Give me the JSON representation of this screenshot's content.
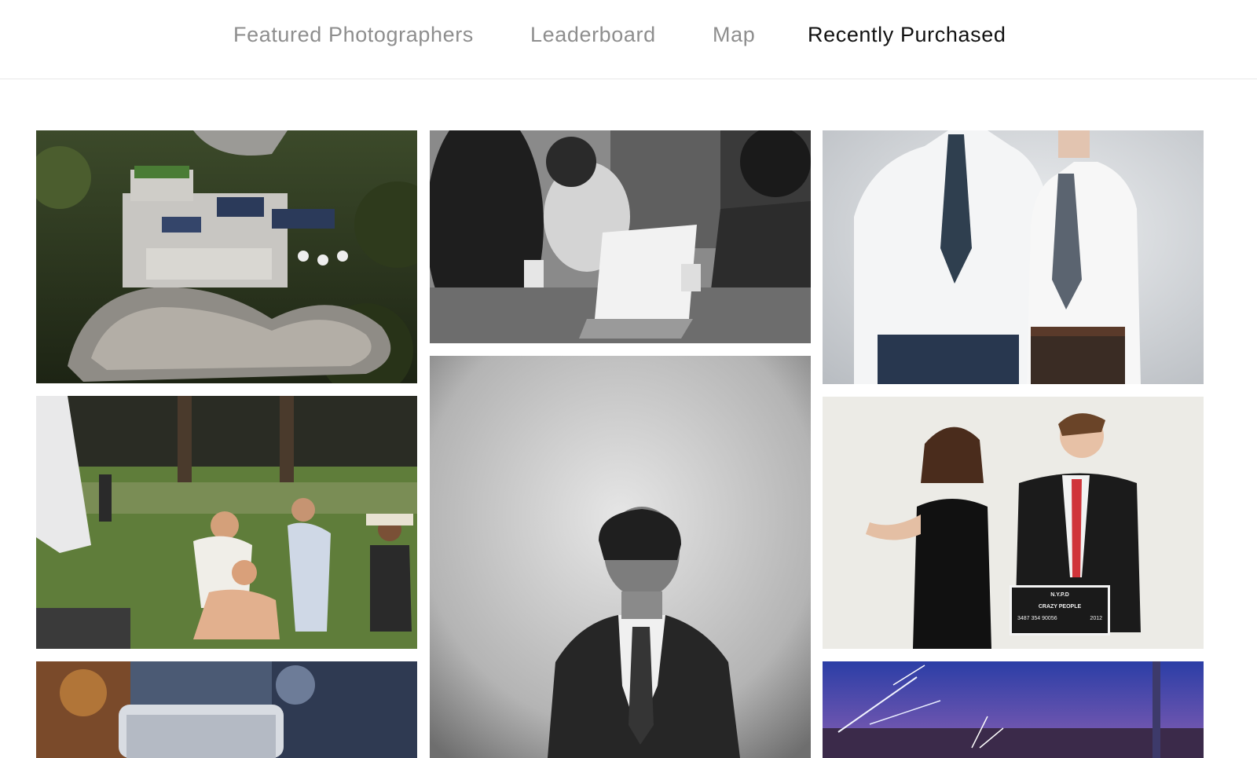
{
  "nav": {
    "items": [
      {
        "label": "Featured Photographers",
        "active": false
      },
      {
        "label": "Leaderboard",
        "active": false
      },
      {
        "label": "Map",
        "active": false
      },
      {
        "label": "Recently Purchased",
        "active": true
      }
    ]
  },
  "gallery": {
    "photos": [
      {
        "subject": "aerial view of hillside mansion"
      },
      {
        "subject": "people working on laptop in cafe"
      },
      {
        "subject": "two men in shirts and ties"
      },
      {
        "subject": "group of friends in park"
      },
      {
        "subject": "man in suit portrait"
      },
      {
        "subject": "couple with mugshot placard",
        "sign_lines": [
          "N.Y.P.D",
          "CRAZY PEOPLE",
          "3487 354 90056",
          "2012"
        ]
      },
      {
        "subject": "glass jar closeup"
      },
      {
        "subject": "sparklers at dusk"
      }
    ]
  },
  "colors": {
    "nav_active": "#111111",
    "nav_inactive": "#8e8e8e",
    "divider": "#e8e8e8"
  }
}
